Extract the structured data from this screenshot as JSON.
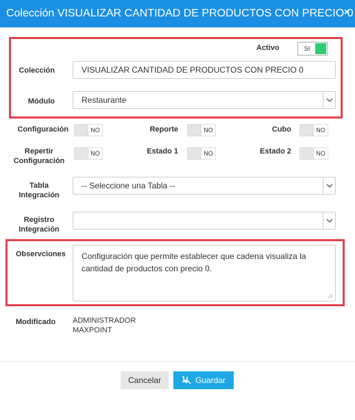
{
  "dialog": {
    "title": "Colección VISUALIZAR CANTIDAD DE PRODUCTOS CON PRECIO 0",
    "close_glyph": "×"
  },
  "form": {
    "activo": {
      "label": "Activo",
      "value": "SI",
      "on": true
    },
    "coleccion": {
      "label": "Colección",
      "value": "VISUALIZAR CANTIDAD DE PRODUCTOS CON PRECIO 0"
    },
    "modulo": {
      "label": "Módulo",
      "value": "Restaurante"
    },
    "configuracion": {
      "label": "Configuración",
      "value": "NO"
    },
    "reporte": {
      "label": "Reporte",
      "value": "NO"
    },
    "cubo": {
      "label": "Cubo",
      "value": "NO"
    },
    "repertir_line1": "Repertir",
    "repertir_line2": "Configuración",
    "repertir_value": "NO",
    "estado1": {
      "label": "Estado 1",
      "value": "NO"
    },
    "estado2": {
      "label": "Estado 2",
      "value": "NO"
    },
    "tabla_line1": "Tabla",
    "tabla_line2": "Integración",
    "tabla_value": "-- Seleccione una Tabla --",
    "registro_line1": "Registro",
    "registro_line2": "Integración",
    "registro_value": "",
    "observaciones": {
      "label": "Observciones",
      "value": "Configuración que permite establecer que cadena visualiza la cantidad de productos con precio 0."
    },
    "modificado": {
      "label": "Modificado",
      "line1": "ADMINISTRADOR",
      "line2": "MAXPOINT"
    }
  },
  "footer": {
    "cancel_label": "Cancelar",
    "save_label": "Guardar"
  },
  "colors": {
    "header": "#1a8fe3",
    "toggle_on": "#2ecc71",
    "highlight": "#e0434a",
    "save_button": "#1ea7e4"
  },
  "icons": [
    "close-icon",
    "chevron-down-icon",
    "save-icon",
    "resize-handle-icon"
  ]
}
